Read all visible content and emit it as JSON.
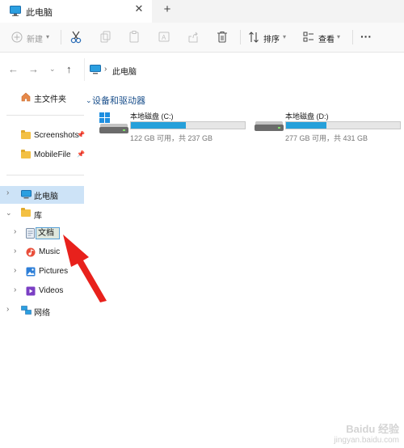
{
  "tab": {
    "title": "此电脑",
    "close_icon": "close-icon",
    "add_icon": "plus-icon"
  },
  "toolbar": {
    "new_label": "新建",
    "sort_label": "排序",
    "view_label": "查看",
    "more_label": "···"
  },
  "address": {
    "crumb": "此电脑",
    "separator": "›"
  },
  "sidebar": {
    "home": "主文件夹",
    "pinned": [
      {
        "label": "Screenshots"
      },
      {
        "label": "MobileFile"
      }
    ],
    "this_pc": "此电脑",
    "libraries": "库",
    "library_items": [
      {
        "label": "文档"
      },
      {
        "label": "Music"
      },
      {
        "label": "Pictures"
      },
      {
        "label": "Videos"
      }
    ],
    "network": "网络"
  },
  "main": {
    "group_title": "设备和驱动器",
    "drives": [
      {
        "name": "本地磁盘 (C:)",
        "space": "122 GB 可用，共 237 GB",
        "used_fraction": 0.485
      },
      {
        "name": "本地磁盘 (D:)",
        "space": "277 GB 可用，共 431 GB",
        "used_fraction": 0.357
      }
    ]
  },
  "rename_value": "文档",
  "watermark": {
    "line1": "Baidu 经验",
    "line2": "jingyan.baidu.com"
  },
  "colors": {
    "accent": "#26a0da",
    "selection": "#cde3f7",
    "arrow": "#e8211c"
  }
}
